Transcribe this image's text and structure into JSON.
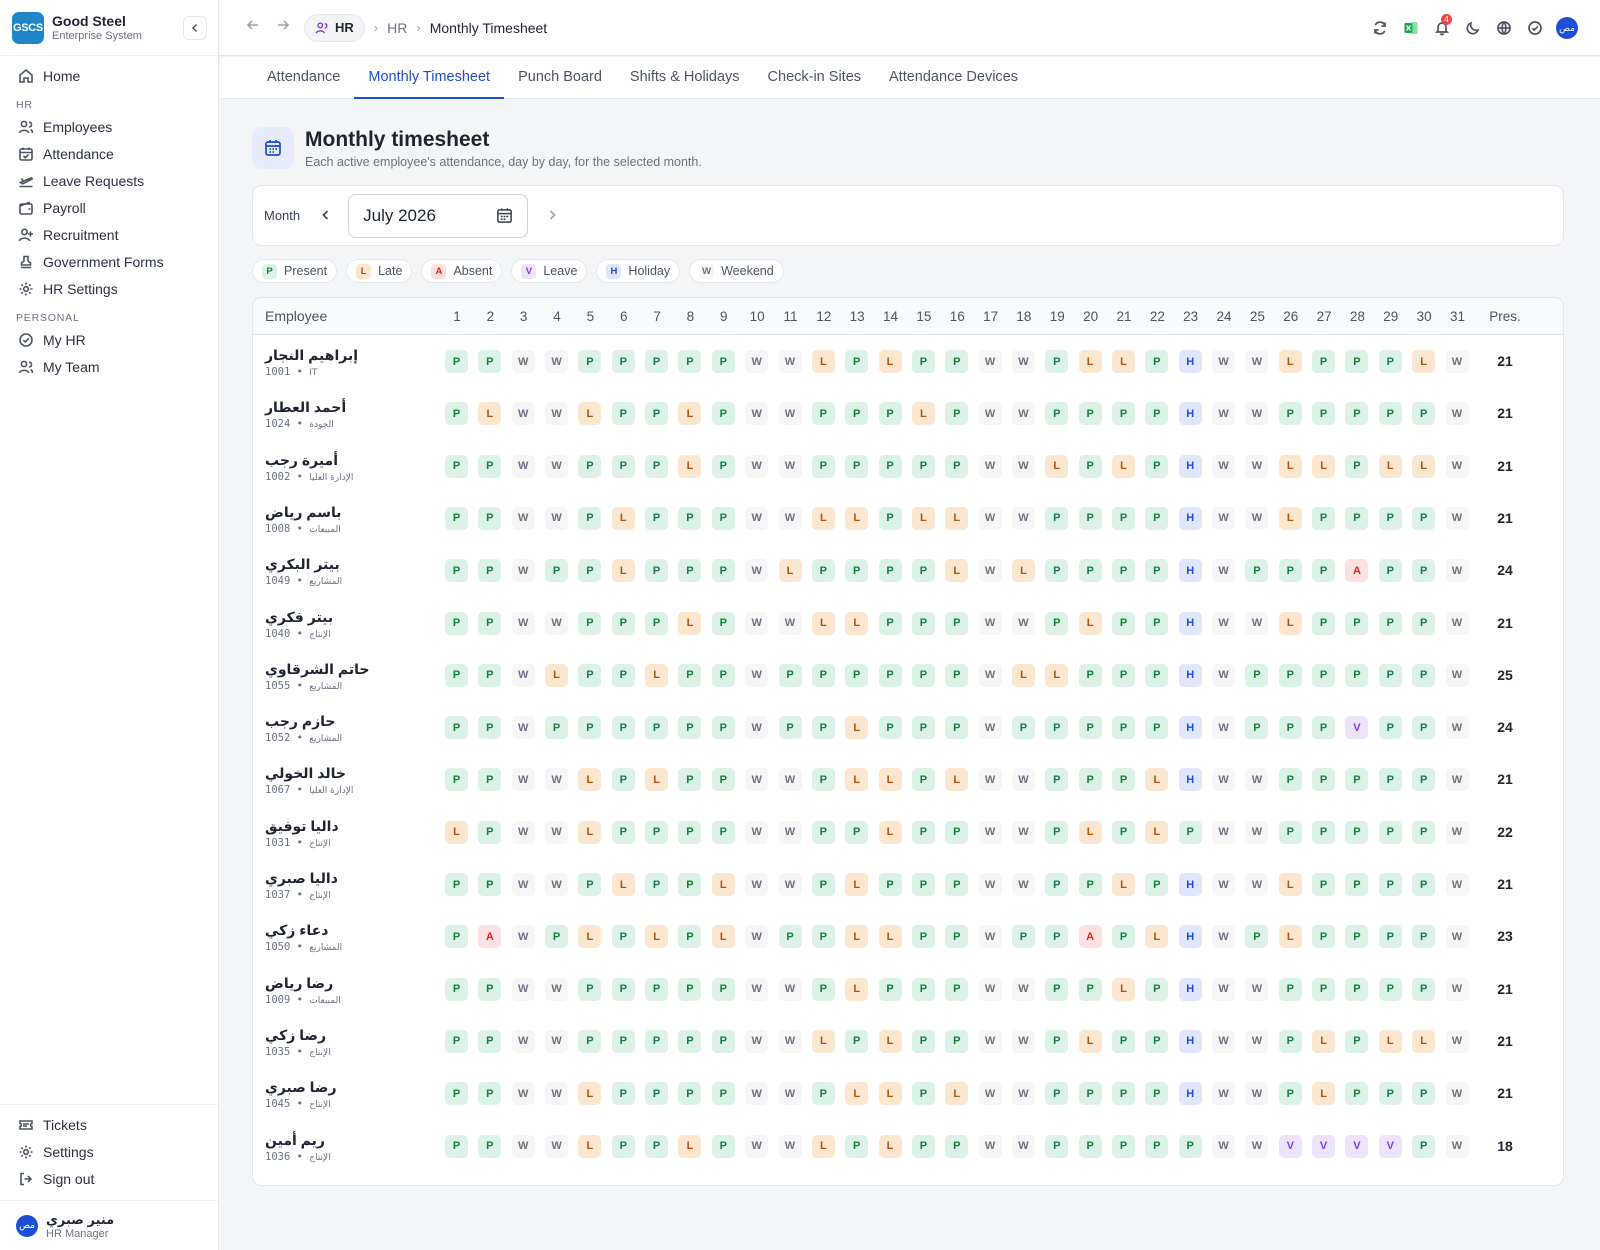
{
  "brand": {
    "logo": "GSCS",
    "name": "Good Steel",
    "subtitle": "Enterprise System"
  },
  "sidebar": {
    "home": "Home",
    "hr_section": "HR",
    "hr_items": [
      "Employees",
      "Attendance",
      "Leave Requests",
      "Payroll",
      "Recruitment",
      "Government Forms",
      "HR Settings"
    ],
    "personal_section": "PERSONAL",
    "personal_items": [
      "My HR",
      "My Team"
    ],
    "bottom_items": [
      "Tickets",
      "Settings",
      "Sign out"
    ],
    "user": {
      "avatar": "مص",
      "name": "منير صبري",
      "role": "HR Manager"
    }
  },
  "topbar": {
    "crumb_pill": "HR",
    "crumb_mid": "HR",
    "crumb_current": "Monthly Timesheet",
    "notification_count": "4",
    "avatar": "مص",
    "icons": [
      "refresh-icon",
      "excel-icon",
      "bell-icon",
      "moon-icon",
      "globe-icon",
      "check-circle-icon"
    ]
  },
  "tabs": [
    "Attendance",
    "Monthly Timesheet",
    "Punch Board",
    "Shifts & Holidays",
    "Check-in Sites",
    "Attendance Devices"
  ],
  "active_tab": 1,
  "header": {
    "title": "Monthly timesheet",
    "subtitle": "Each active employee's attendance, day by day, for the selected month."
  },
  "month_picker": {
    "label": "Month",
    "value": "July 2026"
  },
  "legend": [
    {
      "code": "P",
      "label": "Present"
    },
    {
      "code": "L",
      "label": "Late"
    },
    {
      "code": "A",
      "label": "Absent"
    },
    {
      "code": "V",
      "label": "Leave"
    },
    {
      "code": "H",
      "label": "Holiday"
    },
    {
      "code": "W",
      "label": "Weekend"
    }
  ],
  "table": {
    "col_employee": "Employee",
    "col_present": "Pres.",
    "days": [
      "1",
      "2",
      "3",
      "4",
      "5",
      "6",
      "7",
      "8",
      "9",
      "10",
      "11",
      "12",
      "13",
      "14",
      "15",
      "16",
      "17",
      "18",
      "19",
      "20",
      "21",
      "22",
      "23",
      "24",
      "25",
      "26",
      "27",
      "28",
      "29",
      "30",
      "31"
    ],
    "rows": [
      {
        "name": "إبراهيم النجار",
        "id": "1001",
        "dept": "IT",
        "days": "PPWWPPPPPWWLPLPPWWPLLPHWWLPPPLW",
        "present": "21"
      },
      {
        "name": "أحمد العطار",
        "id": "1024",
        "dept": "الجودة",
        "days": "PLWWLPPLPWWPPPLPWWPPPPHWWPPPPPW",
        "present": "21"
      },
      {
        "name": "أميرة رجب",
        "id": "1002",
        "dept": "الإدارة العليا",
        "days": "PPWWPPPLPWWPPPPPWWLPLPHWWLLPLLW",
        "present": "21"
      },
      {
        "name": "باسم رياض",
        "id": "1008",
        "dept": "المبيعات",
        "days": "PPWWPLPPPWWLLPLLWWPPPPHWWLPPPPW",
        "present": "21"
      },
      {
        "name": "بيتر البكري",
        "id": "1049",
        "dept": "المشاريع",
        "days": "PPWPPLPPPWLPPPPLWLPPPPHWPPPAPPW",
        "present": "24"
      },
      {
        "name": "بيتر فكري",
        "id": "1040",
        "dept": "الإنتاج",
        "days": "PPWWPPPLPWWLLPPPWWPLPPHWWLPPPPW",
        "present": "21"
      },
      {
        "name": "حاتم الشرقاوي",
        "id": "1055",
        "dept": "المشاريع",
        "days": "PPWLPPLPPWPPPPPPWLLPPPHWPPPPPPW",
        "present": "25"
      },
      {
        "name": "حازم رجب",
        "id": "1052",
        "dept": "المشاريع",
        "days": "PPWPPPPPPWPPLPPPWPPPPPHWPPPVPPW",
        "present": "24"
      },
      {
        "name": "خالد الخولي",
        "id": "1067",
        "dept": "الإدارة العليا",
        "days": "PPWWLPLPPWWPLLPLWWPPPLHWWPPPPPW",
        "present": "21"
      },
      {
        "name": "داليا توفيق",
        "id": "1031",
        "dept": "الإنتاج",
        "days": "LPWWLPPPPWWPPLPPWWPLPLPWWPPPPPW",
        "present": "22"
      },
      {
        "name": "داليا صبري",
        "id": "1037",
        "dept": "الإنتاج",
        "days": "PPWWPLPPLWWPLPPPWWPPLPHWWLPPPPW",
        "present": "21"
      },
      {
        "name": "دعاء زكي",
        "id": "1050",
        "dept": "المشاريع",
        "days": "PAWPLPLPLWPPLLPPWPPAPLHWPLPPPPW",
        "present": "23"
      },
      {
        "name": "رضا رياض",
        "id": "1009",
        "dept": "المبيعات",
        "days": "PPWWPPPPPWWPLPPPWWPPLPHWWPPPPPW",
        "present": "21"
      },
      {
        "name": "رضا زكي",
        "id": "1035",
        "dept": "الإنتاج",
        "days": "PPWWPPPPPWWLPLPPWWPLPPHWWPLPLLW",
        "present": "21"
      },
      {
        "name": "رضا صبري",
        "id": "1045",
        "dept": "الإنتاج",
        "days": "PPWWLPPPPWWPLLPLWWPPPPHWWPLPPPW",
        "present": "21"
      },
      {
        "name": "ريم أمين",
        "id": "1036",
        "dept": "الإنتاج",
        "days": "PPWWLPPLPWWLPLPPWWPPPPPWWVVVVPW",
        "present": "18"
      }
    ]
  },
  "colors": {
    "accent": "#1d4ed8",
    "present": "#15803d",
    "late": "#b45309",
    "absent": "#dc2626",
    "leave": "#7c3aed",
    "holiday": "#1d4ed8",
    "weekend": "#6b7280"
  }
}
